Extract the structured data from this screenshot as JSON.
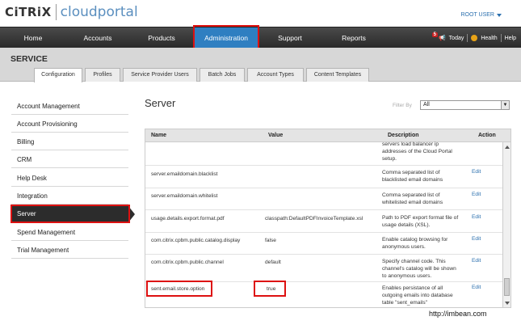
{
  "brand": {
    "mark": "CiTRiX",
    "product": "cloudportal"
  },
  "user": {
    "label": "ROOT USER"
  },
  "nav": {
    "items": [
      {
        "label": "Home"
      },
      {
        "label": "Accounts"
      },
      {
        "label": "Products"
      },
      {
        "label": "Administration"
      },
      {
        "label": "Support"
      },
      {
        "label": "Reports"
      }
    ],
    "today_count": "5",
    "today_label": "Today",
    "health_label": "Health",
    "help_label": "Help"
  },
  "section": {
    "title": "SERVICE"
  },
  "tabs": [
    {
      "label": "Configuration"
    },
    {
      "label": "Profiles"
    },
    {
      "label": "Service Provider Users"
    },
    {
      "label": "Batch Jobs"
    },
    {
      "label": "Account Types"
    },
    {
      "label": "Content Templates"
    }
  ],
  "sidebar": {
    "items": [
      {
        "label": "Account Management"
      },
      {
        "label": "Account Provisioning"
      },
      {
        "label": "Billing"
      },
      {
        "label": "CRM"
      },
      {
        "label": "Help Desk"
      },
      {
        "label": "Integration"
      },
      {
        "label": "Server"
      },
      {
        "label": "Spend Management"
      },
      {
        "label": "Trial Management"
      }
    ]
  },
  "main": {
    "title": "Server",
    "filter_label": "Filter By",
    "filter_value": "All"
  },
  "table": {
    "columns": {
      "name": "Name",
      "value": "Value",
      "description": "Description",
      "action": "Action"
    },
    "rows": [
      {
        "name": "",
        "value": "",
        "desc": [
          "servers load balancer ip",
          "addresses of the Cloud Portal",
          "setup."
        ],
        "action": ""
      },
      {
        "name": "server.emaildomain.blacklist",
        "value": "",
        "desc": [
          "Comma separated list of",
          "blacklisted email domains"
        ],
        "action": "Edit"
      },
      {
        "name": "server.emaildomain.whitelist",
        "value": "",
        "desc": [
          "Comma separated list of",
          "whitelisted email domains"
        ],
        "action": "Edit"
      },
      {
        "name": "usage.details.export.format.pdf",
        "value": "classpath:DefaultPDFInvoiceTemplate.xsl",
        "desc": [
          "Path to PDF export format file of",
          "usage details (XSL)."
        ],
        "action": "Edit"
      },
      {
        "name": "com.citrix.cpbm.public.catalog.display",
        "value": "false",
        "desc": [
          "Enable catalog browsing for",
          "anonymous users."
        ],
        "action": "Edit"
      },
      {
        "name": "com.citrix.cpbm.public.channel",
        "value": "default",
        "desc": [
          "Specify channel code. This",
          "channel's catalog will be shown",
          "to anonymous users."
        ],
        "action": "Edit"
      },
      {
        "name": "sent.email.store.option",
        "value": "true",
        "desc": [
          "Enables persistance of all",
          "outgoing emails into database",
          "table \"sent_emails\""
        ],
        "action": "Edit"
      }
    ]
  },
  "watermark": "http://imbean.com"
}
